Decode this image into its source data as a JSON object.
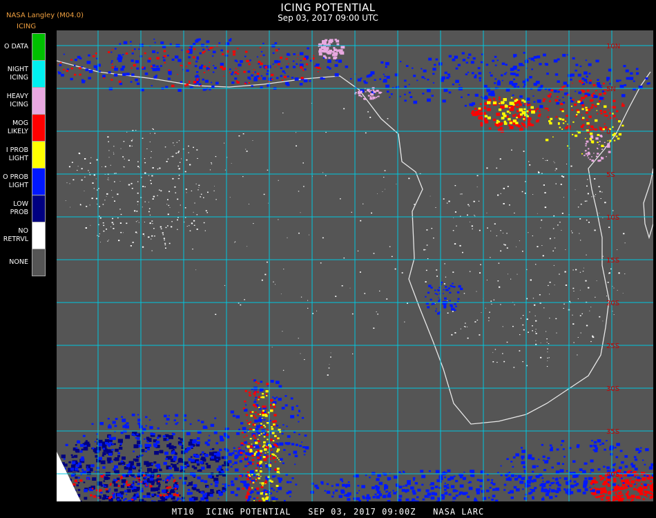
{
  "header": {
    "title": "ICING POTENTIAL",
    "subtitle": "Sep 03, 2017 09:00 UTC",
    "brand": "NASA Langley (M04.0)",
    "product": "ICING"
  },
  "legend": [
    {
      "label": "O DATA",
      "color": "#00c000"
    },
    {
      "label": "NIGHT\nICING",
      "color": "#00f0f0"
    },
    {
      "label": "HEAVY\nICING",
      "color": "#e8a8e0"
    },
    {
      "label": "MOG\nLIKELY",
      "color": "#ff0000"
    },
    {
      "label": "I PROB\nLIGHT",
      "color": "#ffff00"
    },
    {
      "label": "O PROB\nLIGHT",
      "color": "#0018ff"
    },
    {
      "label": "LOW\nPROB",
      "color": "#000080"
    },
    {
      "label": "NO\nRETRVL",
      "color": "#ffffff"
    },
    {
      "label": "NONE",
      "color": "#555555"
    }
  ],
  "map": {
    "background": "#555555",
    "gridline_color": "#00c8e0",
    "coastline_color": "#e8e8e8",
    "label_color": "#c80000",
    "lat_labels": [
      "10N",
      "5N",
      "0",
      "5S",
      "10S",
      "15S",
      "20S",
      "25S",
      "30S",
      "35S",
      "40S"
    ]
  },
  "footer": "MT10  ICING POTENTIAL   SEP 03, 2017 09:00Z   NASA LARC"
}
